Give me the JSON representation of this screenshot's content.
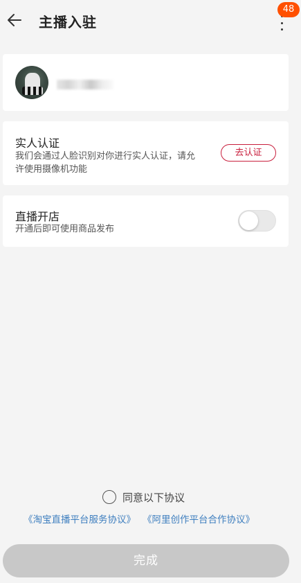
{
  "header": {
    "title": "主播入驻",
    "back_icon": "arrow-left-icon",
    "more_icon": "more-vertical-icon",
    "badge_count": "48",
    "badge_color": "#ff5000"
  },
  "user_card": {
    "avatar_icon": "avatar"
  },
  "verify_card": {
    "title": "实人认证",
    "description": "我们会通过人脸识别对你进行实人认证，请允许使用摄像机功能",
    "button_label": "去认证",
    "accent_color": "#c81e3c"
  },
  "shop_card": {
    "title": "直播开店",
    "description": "开通后即可使用商品发布",
    "toggle_on": false
  },
  "agreement": {
    "label": "同意以下协议",
    "checked": false,
    "link_1": "《淘宝直播平台服务协议》",
    "link_2": "《阿里创作平台合作协议》",
    "link_color": "#3f7fbf"
  },
  "footer": {
    "done_label": "完成",
    "disabled": true
  }
}
